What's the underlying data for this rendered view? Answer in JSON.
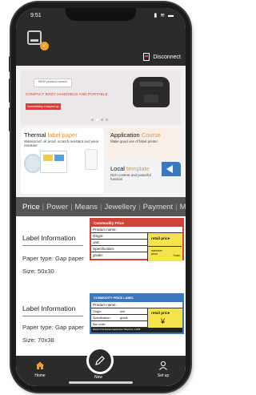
{
  "status_bar": {
    "time": "9:51",
    "icons": "▮ ≋ ▬"
  },
  "header": {
    "logo_badge": "✓",
    "disconnect_label": "Disconnect"
  },
  "banner": {
    "badge": "NEW product launch",
    "title": "COMPACT BODY  HANDHELD AND PORTABLE",
    "button": "Immediately snapped up",
    "slide_count": 4,
    "active_slide": 1
  },
  "cards": {
    "thermal": {
      "title_prefix": "Thermal ",
      "title_accent": "label paper",
      "subtitle": "Waterproof, oil proof, scratch resistant and wear resistant"
    },
    "application": {
      "title_prefix": "Application ",
      "title_accent": "Course",
      "subtitle": "Make good use of label printer"
    },
    "local": {
      "title_prefix": "Local ",
      "title_accent": "template",
      "subtitle": "Rich content and powerful function"
    }
  },
  "tabs": [
    "Price",
    "Power",
    "Means",
    "Jewellery",
    "Payment",
    "M"
  ],
  "active_tab": "Price",
  "templates": [
    {
      "title": "Label Information",
      "paper_type": "Paper type:  Gap paper",
      "size": "Size:  50x30",
      "preview": {
        "header": "Commodity Price",
        "product_name": "Product name:",
        "origin": "Origin:",
        "unit": "unit:",
        "specification": "Specification:",
        "grade": "grade:",
        "retail_price": "retail price",
        "member_price": "member price",
        "yuan": "Yuan"
      }
    },
    {
      "title": "Label Information",
      "paper_type": "Paper type:  Gap paper",
      "size": "Size:  70x38",
      "preview": {
        "header": "COMMODITY PRICE LABEL",
        "product_name": "Product name:",
        "origin": "Origin:",
        "unit": "unit",
        "specification": "Specification:",
        "grade": "grade",
        "bar_code": "Bar code:",
        "retail_price": "retail price",
        "currency": "¥",
        "footer": "Market Price Bureau Supervision Telephone: 12358"
      }
    }
  ],
  "tabbar": {
    "home": "Home",
    "new": "New",
    "setup": "Set up"
  }
}
